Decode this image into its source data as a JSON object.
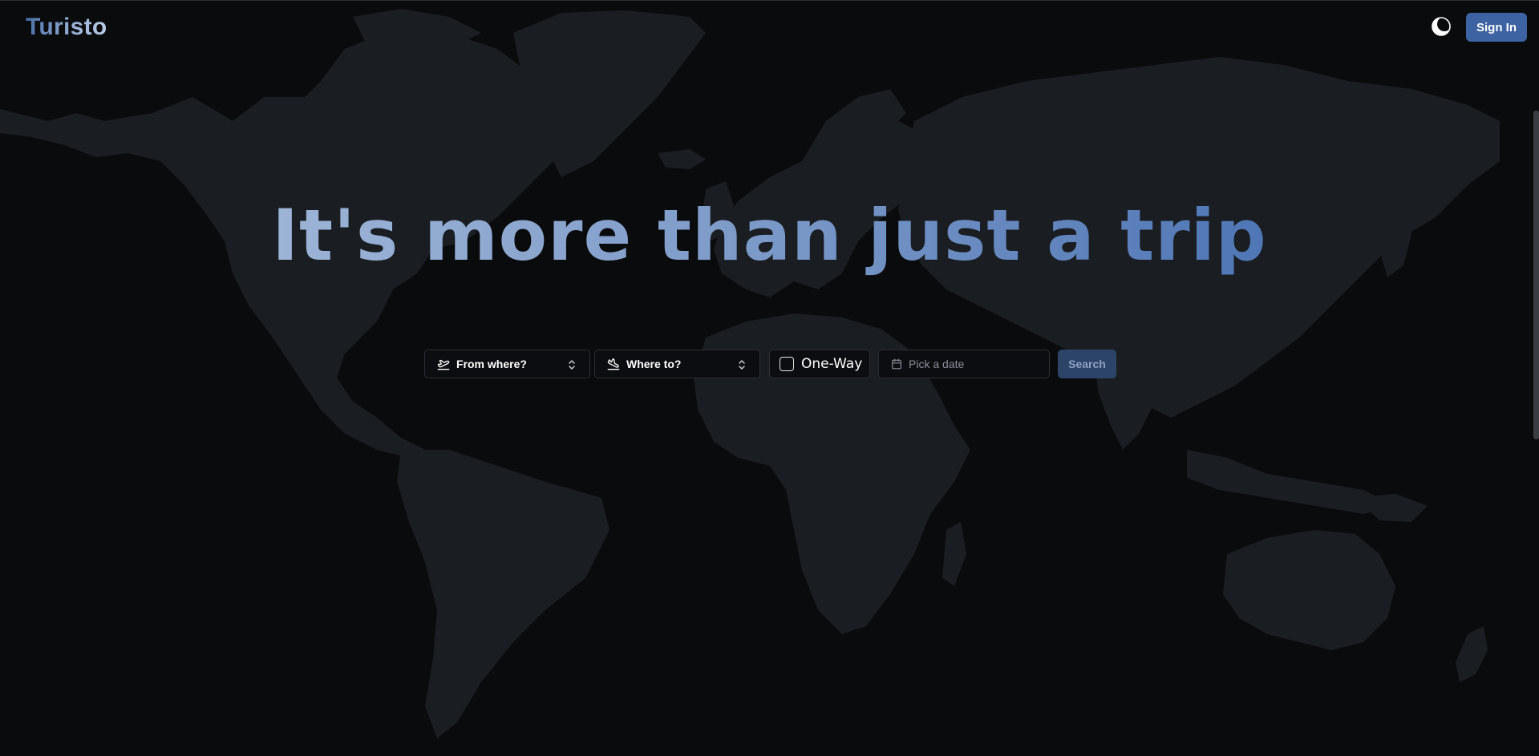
{
  "header": {
    "logo": "Turisto",
    "theme_toggle_icon": "half-moon-icon",
    "signin_label": "Sign In"
  },
  "hero": {
    "headline": "It's more than just a trip"
  },
  "search": {
    "from": {
      "label": "From where?",
      "icon": "plane-takeoff-icon"
    },
    "to": {
      "label": "Where to?",
      "icon": "plane-landing-icon"
    },
    "oneway": {
      "label": "One-Way",
      "checked": false
    },
    "date": {
      "placeholder": "Pick a date",
      "icon": "calendar-icon"
    },
    "search_label": "Search"
  },
  "colors": {
    "background": "#0a0b0d",
    "map": "#1a1e23",
    "accent": "#3d63a3",
    "search_disabled": "#2c4468"
  }
}
